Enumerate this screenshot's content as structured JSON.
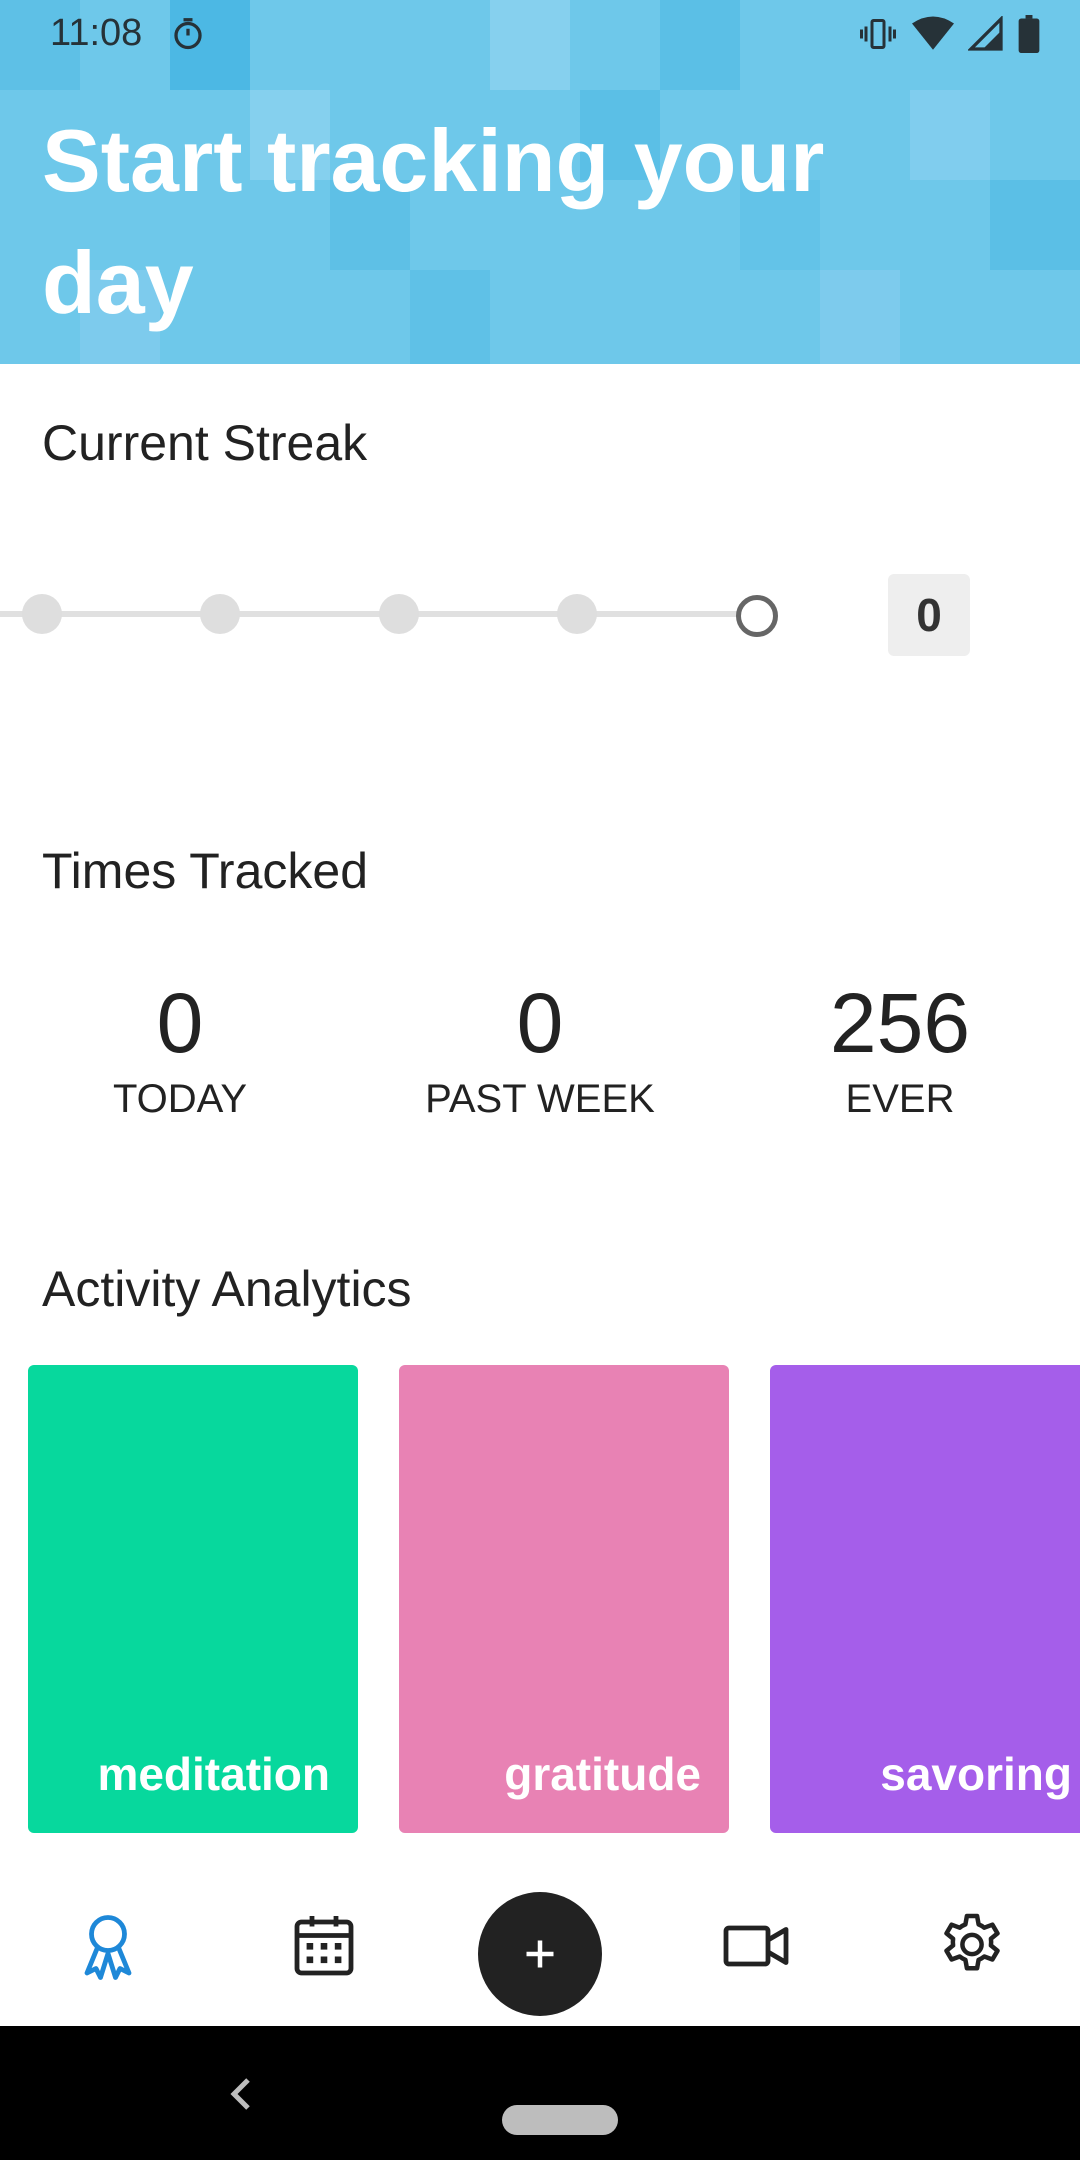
{
  "status_bar": {
    "time": "11:08",
    "icons": [
      "timer-icon",
      "vibrate-icon",
      "wifi-icon",
      "signal-icon",
      "battery-icon"
    ]
  },
  "header": {
    "title": "Start tracking your day",
    "background_color": "#6ec8ea"
  },
  "streak": {
    "title": "Current Streak",
    "count": "0"
  },
  "times_tracked": {
    "title": "Times Tracked",
    "stats": [
      {
        "value": "0",
        "label": "TODAY"
      },
      {
        "value": "0",
        "label": "PAST WEEK"
      },
      {
        "value": "256",
        "label": "EVER"
      }
    ]
  },
  "analytics": {
    "title": "Activity Analytics",
    "cards": [
      {
        "label": "meditation",
        "color": "#07d89d"
      },
      {
        "label": "gratitude",
        "color": "#e882b4"
      },
      {
        "label": "savoring",
        "color": "#a55eea"
      }
    ]
  },
  "bottom_nav": {
    "items": [
      "award-icon",
      "calendar-icon",
      "add-icon",
      "video-icon",
      "settings-icon"
    ],
    "active_color": "#1e88d8"
  }
}
